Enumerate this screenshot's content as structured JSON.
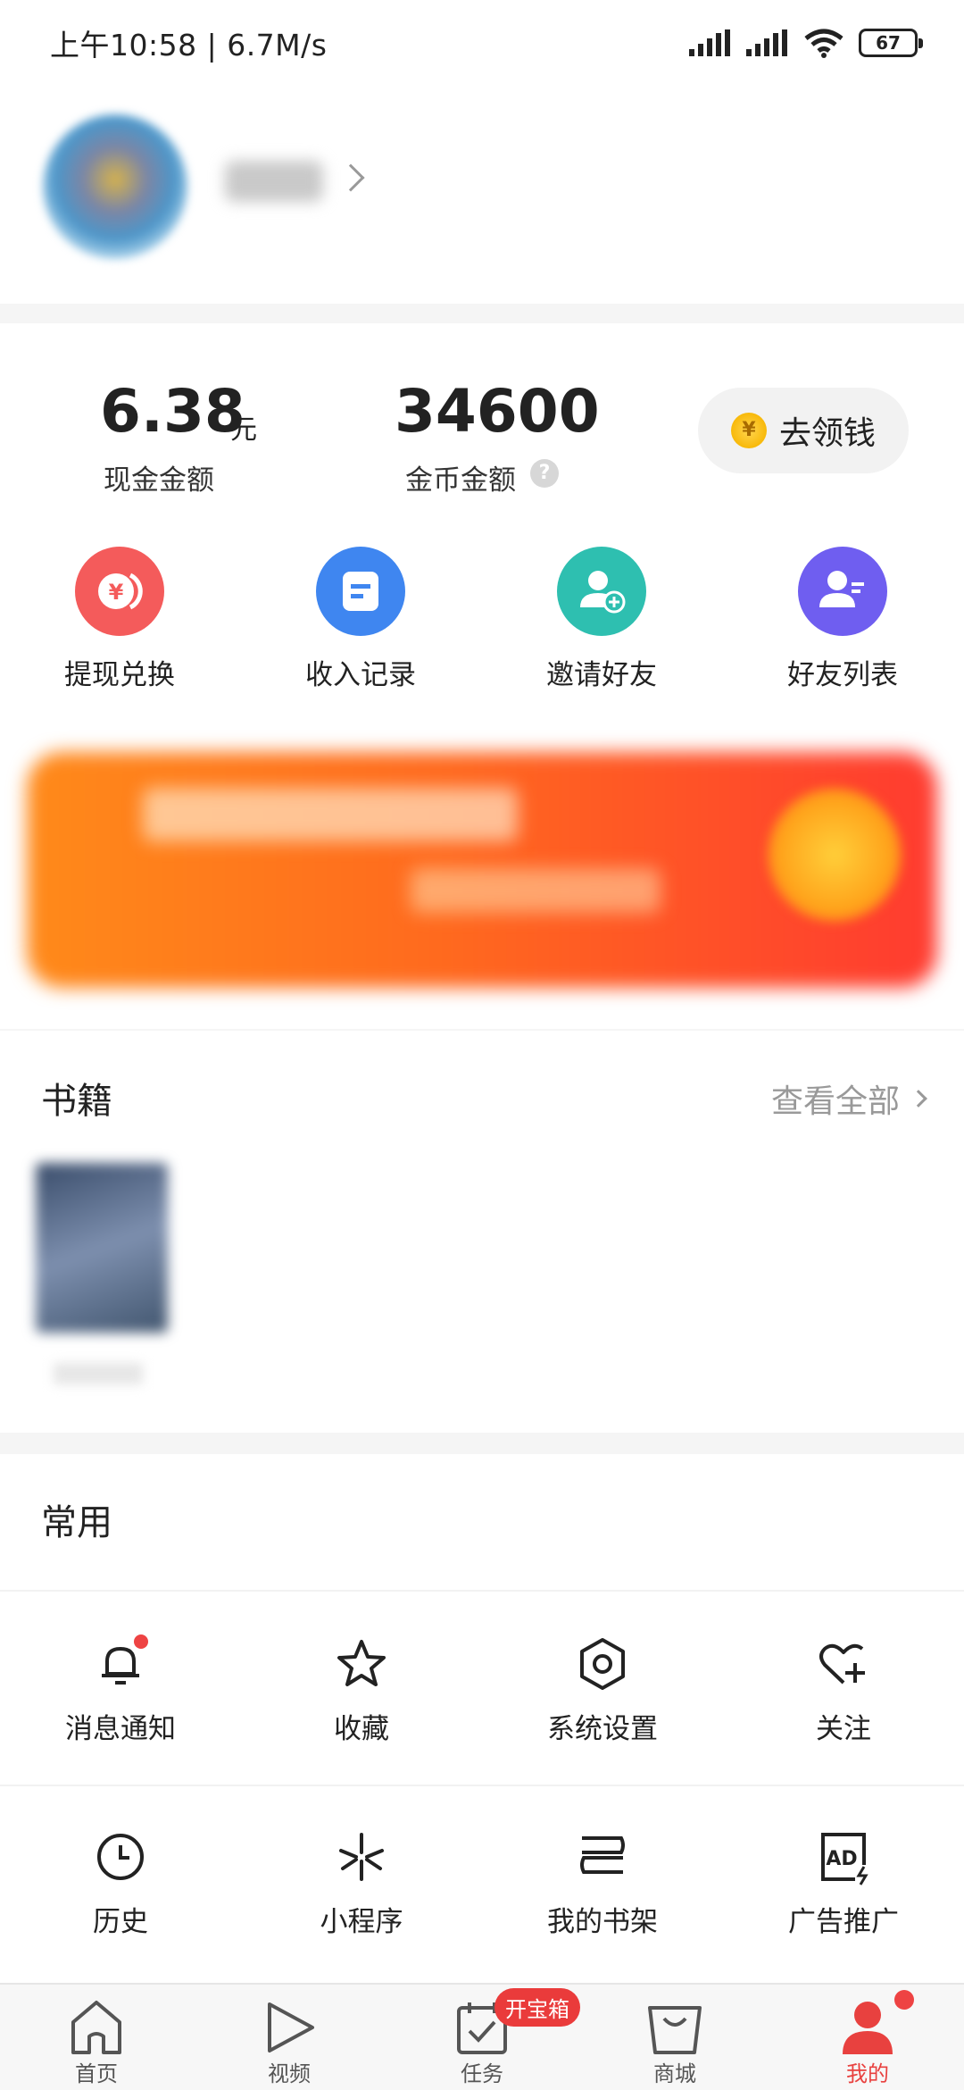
{
  "status_bar": {
    "time": "上午10:58 | 6.7M/s",
    "battery": "67"
  },
  "wallet": {
    "cash_value": "6.38",
    "cash_unit": "元",
    "cash_label": "现金金额",
    "coin_value": "34600",
    "coin_label": "金币金额",
    "help_symbol": "?",
    "coin_symbol": "¥",
    "get_money_label": "去领钱",
    "actions": [
      {
        "label": "提现兑换",
        "color": "#f45b5b"
      },
      {
        "label": "收入记录",
        "color": "#3f86f0"
      },
      {
        "label": "邀请好友",
        "color": "#2ebfb0"
      },
      {
        "label": "好友列表",
        "color": "#6f5ef0"
      }
    ]
  },
  "books": {
    "title": "书籍",
    "see_all": "查看全部"
  },
  "common": {
    "title": "常用",
    "tools": [
      {
        "label": "消息通知",
        "icon": "bell-icon"
      },
      {
        "label": "收藏",
        "icon": "star-icon"
      },
      {
        "label": "系统设置",
        "icon": "gear-icon"
      },
      {
        "label": "关注",
        "icon": "heart-plus-icon"
      },
      {
        "label": "历史",
        "icon": "clock-icon"
      },
      {
        "label": "小程序",
        "icon": "mini-program-icon"
      },
      {
        "label": "我的书架",
        "icon": "bookshelf-icon"
      },
      {
        "label": "广告推广",
        "icon": "ad-icon"
      }
    ]
  },
  "tabbar": {
    "badge": "开宝箱",
    "tabs": [
      {
        "label": "首页",
        "icon": "home-icon"
      },
      {
        "label": "视频",
        "icon": "play-icon"
      },
      {
        "label": "任务",
        "icon": "task-icon"
      },
      {
        "label": "商城",
        "icon": "shopping-bag-icon"
      },
      {
        "label": "我的",
        "icon": "person-icon",
        "active": true
      }
    ]
  },
  "colors": {
    "accent": "#e8413f"
  }
}
